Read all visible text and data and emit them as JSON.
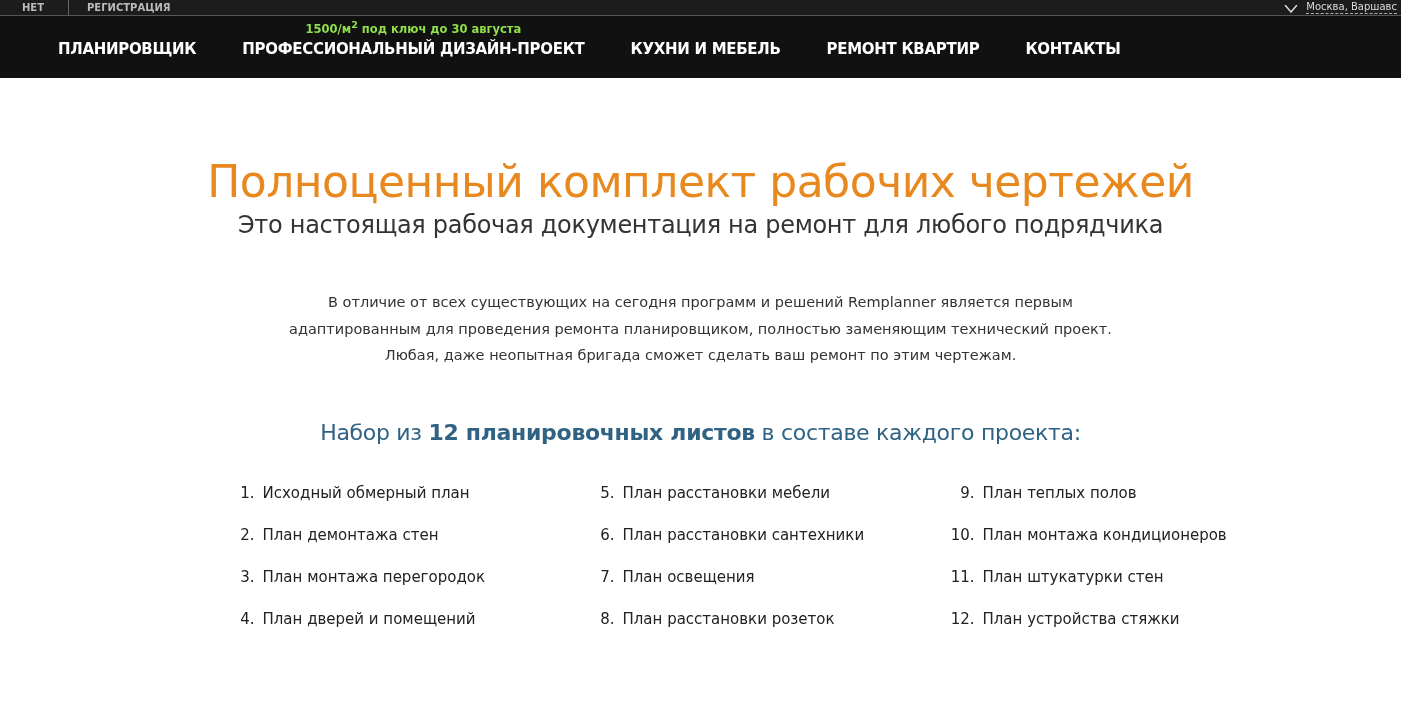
{
  "top_bar": {
    "left_items": [
      "НЕТ",
      "РЕГИСТРАЦИЯ"
    ],
    "location": "Москва, Варшавс"
  },
  "nav": {
    "promo": "1500/м$^{2}$ под ключ до 30 августа",
    "items": [
      "ПЛАНИРОВЩИК",
      "ПРОФЕССИОНАЛЬНЫЙ ДИЗАЙН-ПРОЕКТ",
      "КУХНИ И МЕБЕЛЬ",
      "РЕМОНТ КВАРТИР",
      "КОНТАКТЫ"
    ]
  },
  "title": "Полноценный комплект рабочих чертежей",
  "subtitle": "Это настоящая рабочая документация на ремонт для любого подрядчика",
  "description": "В отличие от всех существующих на сегодня программ и решений Remplanner является первым адаптированным для проведения ремонта планировщиком, полностью заменяющим технический проект. Любая, даже неопытная бригада сможет сделать ваш ремонт по этим чертежам.",
  "sheets_heading": "Набор из **12 планировочных листов** в составе каждого проекта:",
  "columns": [
    {
      "items": [
        {
          "number": "1.",
          "text": "Исходный обмерный план"
        },
        {
          "number": "2.",
          "text": "План демонтажа стен"
        },
        {
          "number": "3.",
          "text": "План монтажа перегородок"
        },
        {
          "number": "4.",
          "text": "План дверей и помещений"
        }
      ]
    },
    {
      "items": [
        {
          "number": "5.",
          "text": "План расстановки мебели"
        },
        {
          "number": "6.",
          "text": "План расстановки сантехники"
        },
        {
          "number": "7.",
          "text": "План освещения"
        },
        {
          "number": "8.",
          "text": "План расстановки розеток"
        }
      ]
    },
    {
      "items": [
        {
          "number": "9.",
          "text": "План теплых полов"
        },
        {
          "number": "10.",
          "text": "План монтажа кондиционеров"
        },
        {
          "number": "11.",
          "text": "План штукатурки стен"
        },
        {
          "number": "12.",
          "text": "План устройства стяжки"
        }
      ]
    }
  ]
}
